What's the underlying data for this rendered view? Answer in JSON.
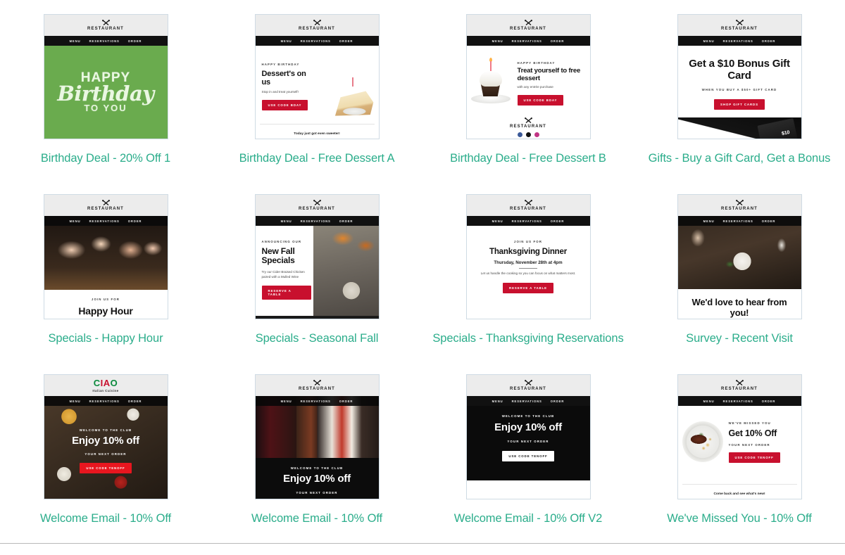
{
  "gallery": {
    "brand_logo_word": "RESTAURANT",
    "ciao_logo": {
      "part1": "C",
      "part2": "IA",
      "part3": "O",
      "subtitle": "Italian Cuisine"
    },
    "nav_items": [
      "MENU",
      "RESERVATIONS",
      "ORDER"
    ],
    "accent_color": "#2bad8b",
    "brand_red": "#c8102e",
    "rows": 3,
    "columns": 4,
    "items": [
      {
        "id": "birthday-deal-20-off-1",
        "caption": "Birthday Deal - 20% Off 1",
        "preview": {
          "style": "green-birthday-art",
          "art_lines": [
            "HAPPY",
            "Birthday",
            "TO YOU"
          ],
          "background_color": "#6aab4e"
        }
      },
      {
        "id": "birthday-deal-free-dessert-a",
        "caption": "Birthday Deal - Free Dessert A",
        "preview": {
          "style": "dessert-left-text",
          "kicker": "HAPPY BIRTHDAY",
          "headline": "Dessert's on us",
          "subcopy": "Stop in and treat yourself!",
          "button": "USE CODE BDAY",
          "footer": "Today just got even sweeter!"
        }
      },
      {
        "id": "birthday-deal-free-dessert-b",
        "caption": "Birthday Deal - Free Dessert B",
        "preview": {
          "style": "cupcake-right-text",
          "kicker": "HAPPY BIRTHDAY",
          "headline": "Treat yourself to free dessert",
          "subcopy": "with any entrée purchase",
          "button": "USE CODE BDAY",
          "footer_logo": "RESTAURANT"
        }
      },
      {
        "id": "gifts-buy-a-gift-card-get-a-bonus",
        "caption": "Gifts - Buy a Gift Card, Get a Bonus",
        "preview": {
          "style": "gift-card-hero",
          "headline": "Get a $10 Bonus Gift Card",
          "subcopy": "WHEN YOU BUY A $50+ GIFT CARD",
          "button": "SHOP GIFT CARDS",
          "card_value": "$10"
        }
      },
      {
        "id": "specials-happy-hour",
        "caption": "Specials - Happy Hour",
        "preview": {
          "style": "photo-top-text-bottom",
          "kicker": "JOIN US FOR",
          "headline": "Happy Hour"
        }
      },
      {
        "id": "specials-seasonal-fall",
        "caption": "Specials - Seasonal Fall",
        "preview": {
          "style": "split-text-left-photo-right",
          "kicker": "ANNOUNCING OUR",
          "headline": "New Fall Specials",
          "subcopy": "Try our Cider Braised Chicken paired with a Mulled Wine",
          "button": "RESERVE A TABLE"
        }
      },
      {
        "id": "specials-thanksgiving-reservations",
        "caption": "Specials - Thanksgiving Reservations",
        "preview": {
          "style": "centered-text",
          "kicker": "JOIN US FOR",
          "headline": "Thanksgiving Dinner",
          "subhead": "Thursday, November 28th at 4pm",
          "subcopy": "Let us handle the cooking so you can focus on what matters most.",
          "button": "RESERVE A TABLE"
        }
      },
      {
        "id": "survey-recent-visit",
        "caption": "Survey - Recent Visit",
        "preview": {
          "style": "photo-top-text-bottom",
          "headline": "We'd love to hear from you!"
        }
      },
      {
        "id": "welcome-email-10-off",
        "caption": "Welcome Email - 10% Off",
        "preview": {
          "style": "ciao-food-hero",
          "kicker": "WELCOME TO THE CLUB",
          "headline": "Enjoy 10% off",
          "subcopy": "YOUR NEXT ORDER",
          "button": "USE CODE TENOFF"
        }
      },
      {
        "id": "welcome-email-10-off-b",
        "caption": "Welcome Email - 10% Off",
        "preview": {
          "style": "triptych-dark",
          "kicker": "WELCOME TO THE CLUB",
          "headline": "Enjoy 10% off",
          "subcopy": "YOUR NEXT ORDER"
        }
      },
      {
        "id": "welcome-email-10-off-v2",
        "caption": "Welcome Email - 10% Off V2",
        "preview": {
          "style": "dark-panel",
          "kicker": "WELCOME TO THE CLUB",
          "headline": "Enjoy 10% off",
          "subcopy": "YOUR NEXT ORDER",
          "button": "USE CODE TENOFF"
        }
      },
      {
        "id": "weve-missed-you-10-off",
        "caption": "We've Missed You - 10% Off",
        "preview": {
          "style": "steak-left-text-right",
          "kicker": "WE'VE MISSED YOU",
          "headline": "Get 10% Off",
          "subcopy": "YOUR NEXT ORDER",
          "button": "USE CODE TENOFF",
          "footer": "Come back and see what's new!"
        }
      }
    ]
  }
}
